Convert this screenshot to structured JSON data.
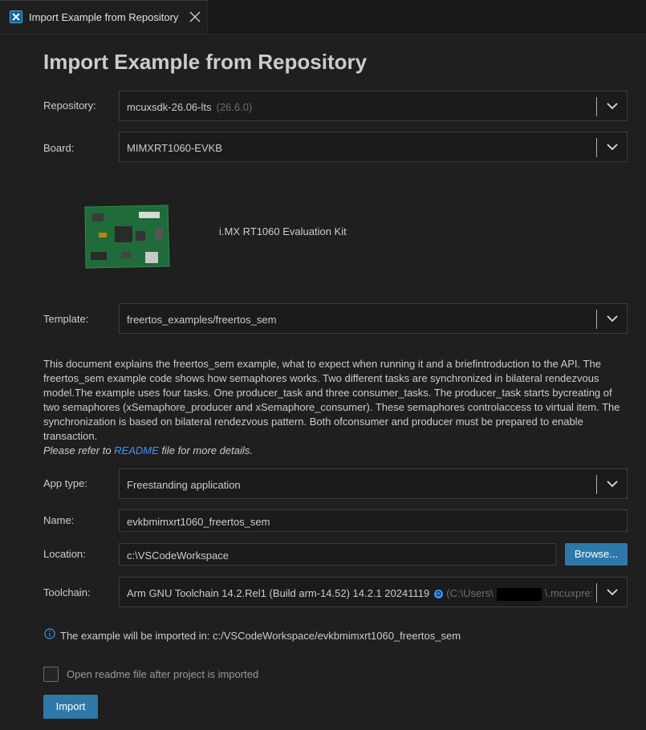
{
  "tab": {
    "icon": "x-logo-icon",
    "title": "Import Example from Repository"
  },
  "page_title": "Import Example from Repository",
  "repository": {
    "label": "Repository:",
    "value": "mcuxsdk-26.06-lts",
    "version": "(26.6.0)"
  },
  "board": {
    "label": "Board:",
    "value": "MIMXRT1060-EVKB",
    "name": "i.MX RT1060 Evaluation Kit"
  },
  "template": {
    "label": "Template:",
    "value": "freertos_examples/freertos_sem"
  },
  "description": {
    "text": "This document explains the freertos_sem example, what to expect when running it and a briefintroduction to the API. The freertos_sem example code shows how semaphores works. Two different tasks are synchronized in bilateral rendezvous model.The example uses four tasks. One producer_task and three consumer_tasks. The producer_task starts bycreating of two semaphores (xSemaphore_producer and xSemaphore_consumer). These semaphores controlaccess to virtual item. The synchronization is based on bilateral rendezvous pattern. Both ofconsumer and producer must be prepared to enable transaction.",
    "hint_before": "Please refer to ",
    "hint_link": "README",
    "hint_after": " file for more details."
  },
  "app_type": {
    "label": "App type:",
    "value": "Freestanding application"
  },
  "name": {
    "label": "Name:",
    "value": "evkbmimxrt1060_freertos_sem"
  },
  "location": {
    "label": "Location:",
    "value": "c:\\VSCodeWorkspace",
    "browse_label": "Browse..."
  },
  "toolchain": {
    "label": "Toolchain:",
    "value": "Arm GNU Toolchain 14.2.Rel1 (Build arm-14.52) 14.2.1 20241119",
    "badge": "D",
    "path_start": "(C:\\Users\\",
    "path_end": "\\.mcuxpre:"
  },
  "info": {
    "icon": "info-icon",
    "text": "The example will be imported in: c:/VSCodeWorkspace/evkbmimxrt1060_freertos_sem"
  },
  "open_readme": {
    "label": "Open readme file after project is imported",
    "checked": false
  },
  "import_label": "Import",
  "colors": {
    "accent": "#2d79a8",
    "background": "#1f1f1f",
    "link": "#3794ff"
  }
}
